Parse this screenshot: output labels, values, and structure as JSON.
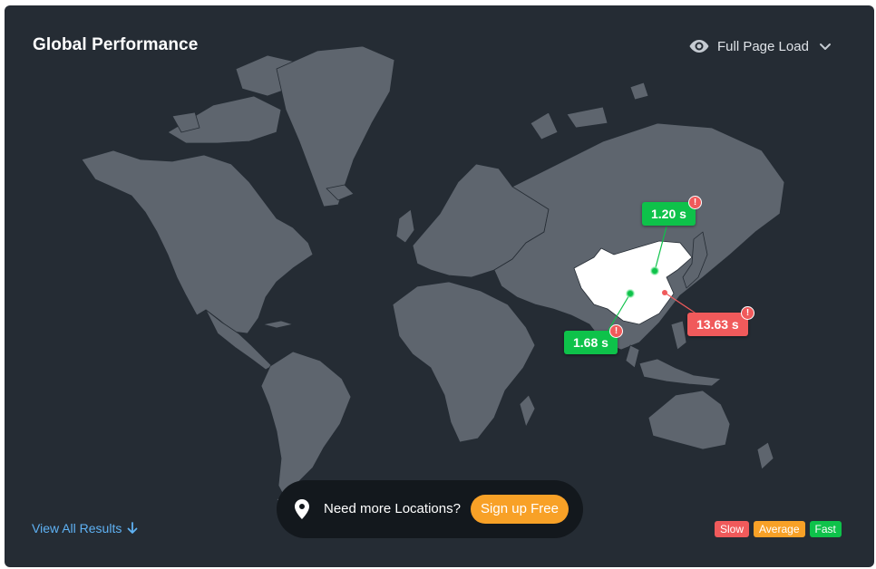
{
  "header": {
    "title": "Global Performance",
    "metric_label": "Full Page Load"
  },
  "markers": [
    {
      "value": "1.20 s",
      "status": "fast",
      "warning": "!"
    },
    {
      "value": "13.63 s",
      "status": "slow",
      "warning": "!"
    },
    {
      "value": "1.68 s",
      "status": "fast",
      "warning": "!"
    }
  ],
  "footer": {
    "view_all_label": "View All Results",
    "cta_message": "Need more Locations?",
    "cta_button": "Sign up Free"
  },
  "legend": {
    "slow": "Slow",
    "average": "Average",
    "fast": "Fast"
  },
  "colors": {
    "background": "#252c34",
    "land": "#5e656e",
    "highlight": "#ffffff",
    "fast": "#0ec24a",
    "slow": "#f05a5b",
    "average": "#f8a127",
    "link": "#5fb2f4"
  }
}
